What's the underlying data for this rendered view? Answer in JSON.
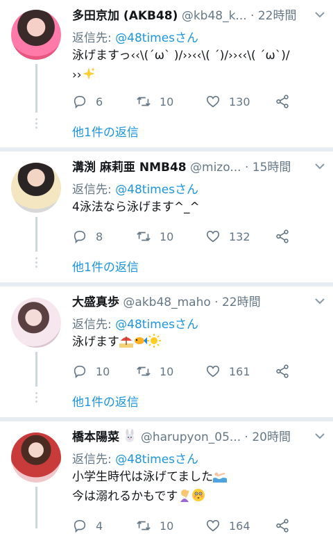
{
  "tweets": [
    {
      "name": "多田京加 (AKB48)",
      "handle": "@kb48_k...",
      "time": "22時間",
      "reply_prefix": "返信先: ",
      "reply_mention": "@48timesさん",
      "text_line1": "泳げますっ‹‹\\(´ω` )/››‹‹\\( ´)/››‹‹\\( ´ω`)/",
      "text_line2": "››",
      "reply_count": "6",
      "retweet_count": "10",
      "like_count": "130",
      "more_label": "他1件の返信"
    },
    {
      "name": "溝渕 麻莉亜 NMB48",
      "handle": "@mizo...",
      "time": "15時間",
      "reply_prefix": "返信先: ",
      "reply_mention": "@48timesさん",
      "text_line1": "4泳法なら泳げます^_^",
      "reply_count": "8",
      "retweet_count": "10",
      "like_count": "132",
      "more_label": "他1件の返信"
    },
    {
      "name": "大盛真歩",
      "handle": "@akb48_maho",
      "time": "22時間",
      "reply_prefix": "返信先: ",
      "reply_mention": "@48timesさん",
      "text_line1": "泳げます",
      "reply_count": "10",
      "retweet_count": "10",
      "like_count": "161",
      "more_label": "他1件の返信"
    },
    {
      "name": "橋本陽菜",
      "handle": "@harupyon_05...",
      "time": "20時間",
      "reply_prefix": "返信先: ",
      "reply_mention": "@48timesさん",
      "text_line1": "小学生時代は泳げてました",
      "text_line2": "今は溺れるかもです",
      "reply_count": "4",
      "retweet_count": "10",
      "like_count": "164"
    }
  ],
  "time_separator": " · ",
  "colors": {
    "link": "#1b95e0",
    "secondary": "#657786",
    "divider": "#e6ecf0"
  },
  "icons": [
    "reply-icon",
    "retweet-icon",
    "like-icon",
    "share-icon",
    "chevron-down-icon"
  ]
}
